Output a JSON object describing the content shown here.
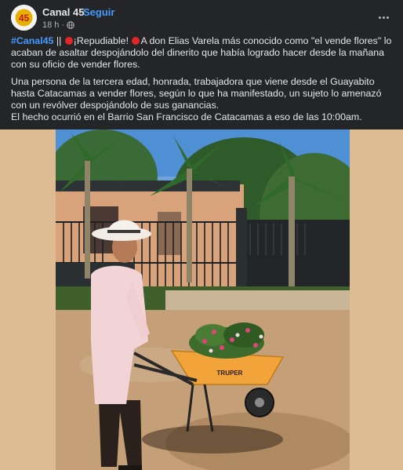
{
  "header": {
    "avatar_text": "45",
    "page_name": "Canal 45",
    "separator": "·",
    "follow_label": "Seguir",
    "time": "18 h",
    "time_separator": "·",
    "privacy_icon": "globe-icon",
    "more_icon": "more-options-icon"
  },
  "post": {
    "hashtag": "#Canal45",
    "line1_a": " || ",
    "line1_b": "¡Repudiable! ",
    "line1_c": "A don Elias Varela más conocido como \"el vende flores\" lo acaban de asaltar despojándolo del dinerito que había logrado hacer desde la mañana con su oficio de vender flores.",
    "paragraph2": "Una persona de la tercera edad, honrada, trabajadora que viene desde el Guayabito hasta Catacamas a vender flores, según lo que ha manifestado, un sujeto lo amenazó con un revólver despojándolo de sus ganancias.",
    "paragraph3": "El hecho ocurrió en el Barrio San Francisco de Catacamas a eso de las 10:00am."
  },
  "photo": {
    "wheelbarrow_brand": "TRUPER"
  },
  "colors": {
    "background": "#242526",
    "accent": "#4599ff",
    "photo_margin": "#ddbc93",
    "red_dot": "#e0262b"
  }
}
